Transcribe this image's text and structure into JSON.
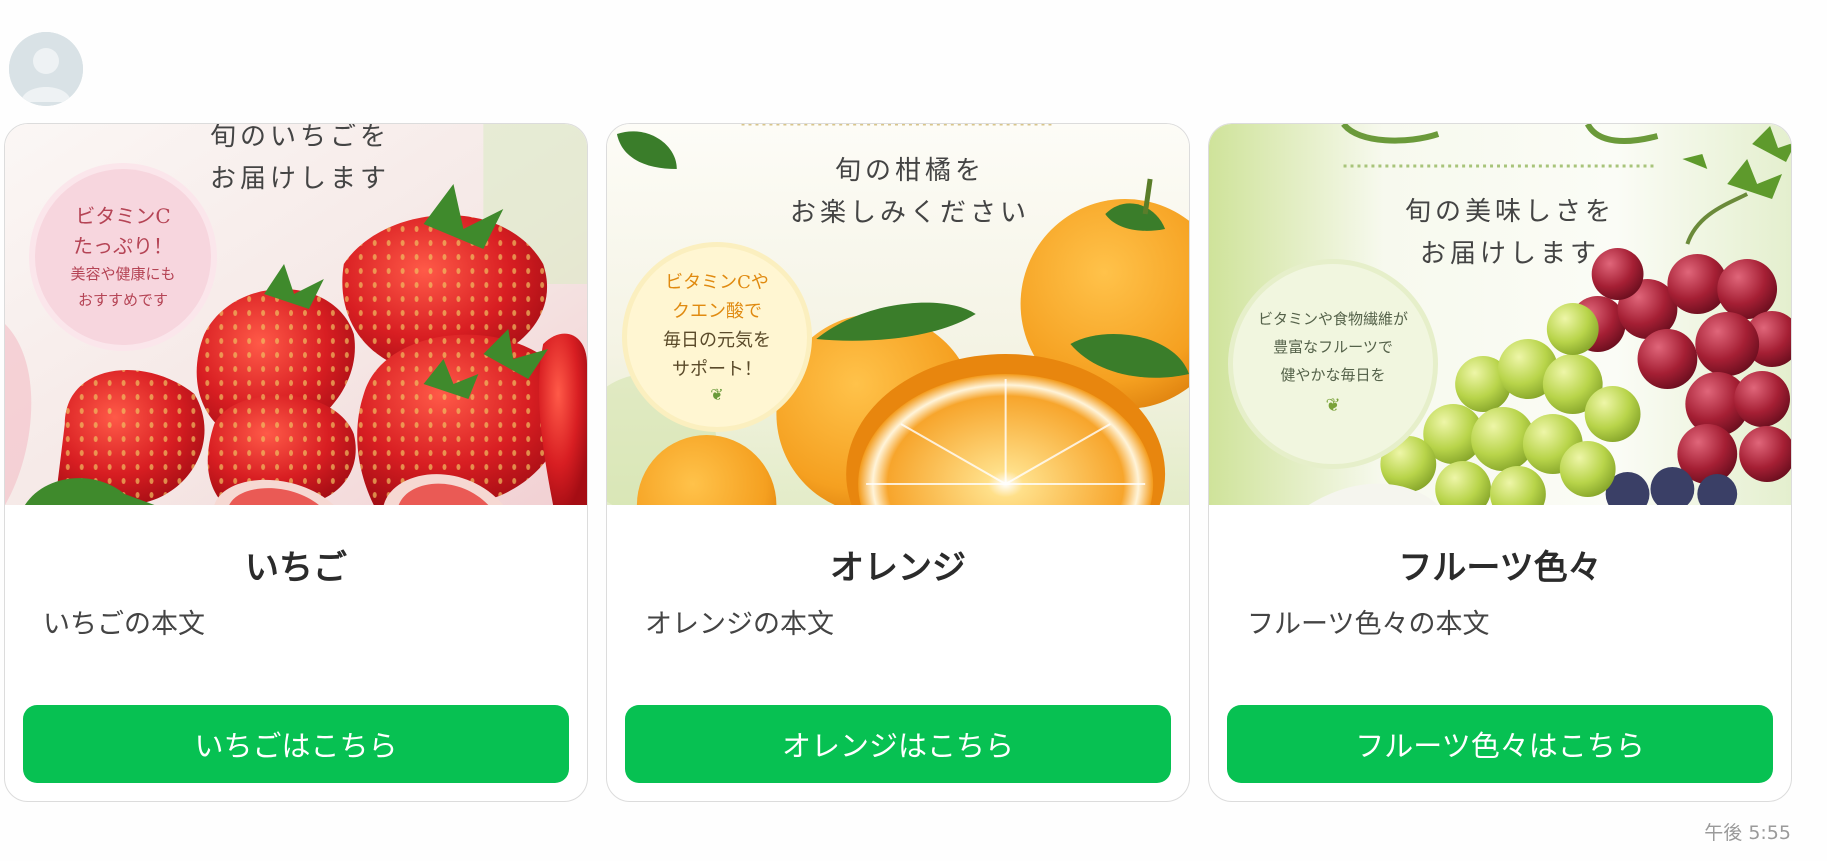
{
  "chat": {
    "avatar_icon": "default-user-avatar",
    "timestamp": "午後 5:55"
  },
  "cards": [
    {
      "image": {
        "tagline": [
          "旬のいちごを",
          "お届けします"
        ],
        "badge": [
          "ビタミンC",
          "たっぷり！",
          "美容や健康にも",
          "おすすめです"
        ]
      },
      "title": "いちご",
      "text": "いちごの本文",
      "button": "いちごはこちら"
    },
    {
      "image": {
        "tagline": [
          "旬の柑橘を",
          "お楽しみください"
        ],
        "badge": [
          "ビタミンCや",
          "クエン酸で",
          "毎日の元気を",
          "サポート！"
        ]
      },
      "title": "オレンジ",
      "text": "オレンジの本文",
      "button": "オレンジはこちら"
    },
    {
      "image": {
        "tagline": [
          "旬の美味しさを",
          "お届けします"
        ],
        "badge": [
          "ビタミンや食物繊維が",
          "豊富なフルーツで",
          "健やかな毎日を"
        ]
      },
      "title": "フルーツ色々",
      "text": "フルーツ色々の本文",
      "button": "フルーツ色々はこちら"
    }
  ],
  "colors": {
    "button_green": "#07c152",
    "strawberry_red": "#d81e22",
    "orange": "#f5a020",
    "grape_red": "#a51f34",
    "grape_green": "#b8d44a",
    "badge_pink": "#f7d6de",
    "badge_yellow": "#fff6d2",
    "badge_green": "#f1f6df"
  }
}
